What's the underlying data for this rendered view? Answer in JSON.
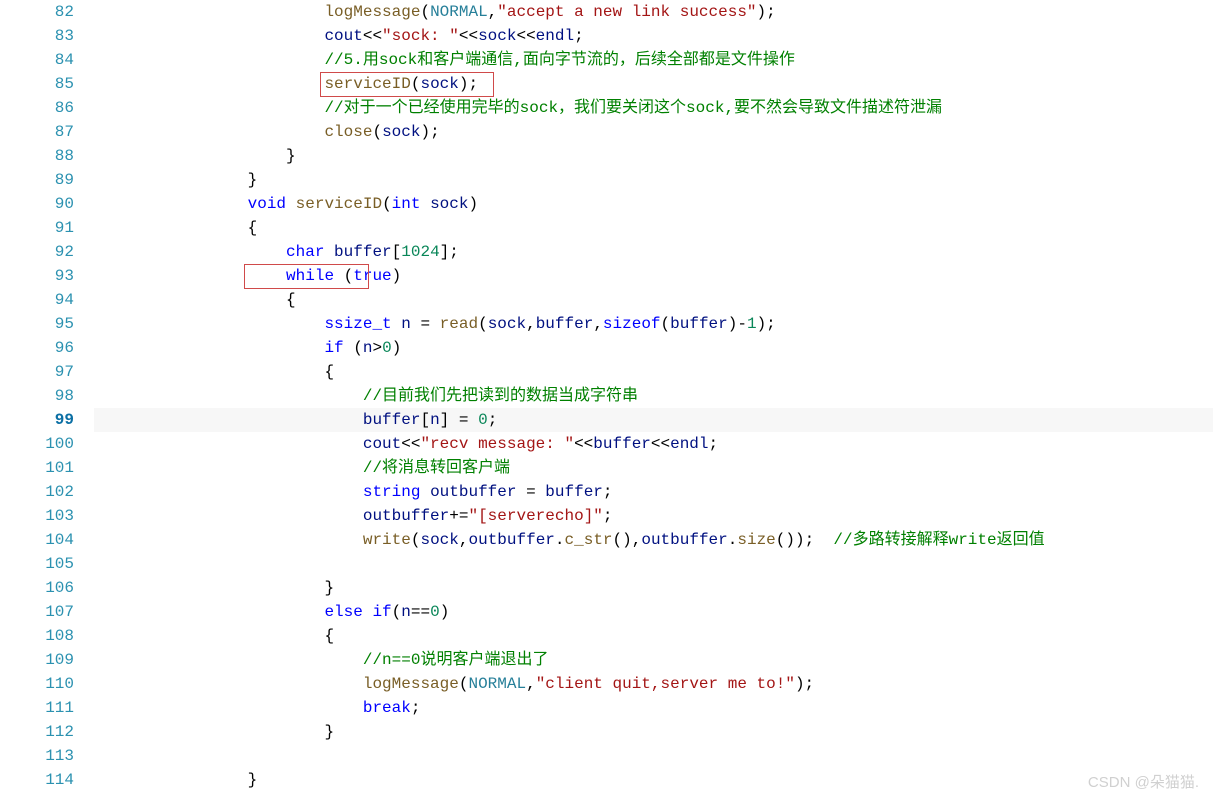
{
  "watermark": "CSDN @朵猫猫.",
  "line_start": 82,
  "line_count": 33,
  "current_line": 99,
  "boxes": [
    {
      "top_line": 85,
      "left_ch": 6,
      "width_ch": 17
    },
    {
      "top_line": 93,
      "left_ch": 4,
      "width_ch": 12
    }
  ],
  "indent_unit": "    ",
  "tokens": {
    "l82": [
      {
        "indent": 6
      },
      {
        "t": "logMessage",
        "c": "fn"
      },
      {
        "t": "("
      },
      {
        "t": "NORMAL",
        "c": "enum"
      },
      {
        "t": ","
      },
      {
        "t": "\"accept a new link success\"",
        "c": "str"
      },
      {
        "t": ");"
      }
    ],
    "l83": [
      {
        "indent": 6
      },
      {
        "t": "cout",
        "c": "var"
      },
      {
        "t": "<<"
      },
      {
        "t": "\"sock: \"",
        "c": "str"
      },
      {
        "t": "<<"
      },
      {
        "t": "sock",
        "c": "var"
      },
      {
        "t": "<<"
      },
      {
        "t": "endl",
        "c": "var"
      },
      {
        "t": ";"
      }
    ],
    "l84": [
      {
        "indent": 6
      },
      {
        "t": "//5.用sock和客户端通信,面向字节流的，后续全部都是文件操作",
        "c": "cm"
      }
    ],
    "l85": [
      {
        "indent": 6
      },
      {
        "t": "serviceID",
        "c": "fn"
      },
      {
        "t": "("
      },
      {
        "t": "sock",
        "c": "var"
      },
      {
        "t": ");"
      }
    ],
    "l86": [
      {
        "indent": 6
      },
      {
        "t": "//对于一个已经使用完毕的sock，我们要关闭这个sock,要不然会导致文件描述符泄漏",
        "c": "cm"
      }
    ],
    "l87": [
      {
        "indent": 6
      },
      {
        "t": "close",
        "c": "fn"
      },
      {
        "t": "("
      },
      {
        "t": "sock",
        "c": "var"
      },
      {
        "t": ");"
      }
    ],
    "l88": [
      {
        "indent": 5
      },
      {
        "t": "}"
      }
    ],
    "l89": [
      {
        "indent": 4
      },
      {
        "t": "}"
      }
    ],
    "l90": [
      {
        "indent": 4
      },
      {
        "t": "void ",
        "c": "kw"
      },
      {
        "t": "serviceID",
        "c": "fn"
      },
      {
        "t": "("
      },
      {
        "t": "int ",
        "c": "kw"
      },
      {
        "t": "sock",
        "c": "var"
      },
      {
        "t": ")"
      }
    ],
    "l91": [
      {
        "indent": 4
      },
      {
        "t": "{"
      }
    ],
    "l92": [
      {
        "indent": 5
      },
      {
        "t": "char ",
        "c": "kw"
      },
      {
        "t": "buffer",
        "c": "var"
      },
      {
        "t": "["
      },
      {
        "t": "1024",
        "c": "num"
      },
      {
        "t": "];"
      }
    ],
    "l93": [
      {
        "indent": 5
      },
      {
        "t": "while ",
        "c": "kw"
      },
      {
        "t": "("
      },
      {
        "t": "true",
        "c": "kw"
      },
      {
        "t": ")"
      }
    ],
    "l94": [
      {
        "indent": 5
      },
      {
        "t": "{"
      }
    ],
    "l95": [
      {
        "indent": 6
      },
      {
        "t": "ssize_t ",
        "c": "ty"
      },
      {
        "t": "n",
        "c": "var"
      },
      {
        "t": " = "
      },
      {
        "t": "read",
        "c": "fn"
      },
      {
        "t": "("
      },
      {
        "t": "sock",
        "c": "var"
      },
      {
        "t": ","
      },
      {
        "t": "buffer",
        "c": "var"
      },
      {
        "t": ","
      },
      {
        "t": "sizeof",
        "c": "kw"
      },
      {
        "t": "("
      },
      {
        "t": "buffer",
        "c": "var"
      },
      {
        "t": ")-"
      },
      {
        "t": "1",
        "c": "num"
      },
      {
        "t": ");"
      }
    ],
    "l96": [
      {
        "indent": 6
      },
      {
        "t": "if ",
        "c": "kw"
      },
      {
        "t": "("
      },
      {
        "t": "n",
        "c": "var"
      },
      {
        "t": ">"
      },
      {
        "t": "0",
        "c": "num"
      },
      {
        "t": ")"
      }
    ],
    "l97": [
      {
        "indent": 6
      },
      {
        "t": "{"
      }
    ],
    "l98": [
      {
        "indent": 7
      },
      {
        "t": "//目前我们先把读到的数据当成字符串",
        "c": "cm"
      }
    ],
    "l99": [
      {
        "indent": 7
      },
      {
        "t": "buffer",
        "c": "var"
      },
      {
        "t": "["
      },
      {
        "t": "n",
        "c": "var"
      },
      {
        "t": "] = "
      },
      {
        "t": "0",
        "c": "num"
      },
      {
        "t": ";"
      }
    ],
    "l100": [
      {
        "indent": 7
      },
      {
        "t": "cout",
        "c": "var"
      },
      {
        "t": "<<"
      },
      {
        "t": "\"recv message: \"",
        "c": "str"
      },
      {
        "t": "<<"
      },
      {
        "t": "buffer",
        "c": "var"
      },
      {
        "t": "<<"
      },
      {
        "t": "endl",
        "c": "var"
      },
      {
        "t": ";"
      }
    ],
    "l101": [
      {
        "indent": 7
      },
      {
        "t": "//将消息转回客户端",
        "c": "cm"
      }
    ],
    "l102": [
      {
        "indent": 7
      },
      {
        "t": "string ",
        "c": "ty"
      },
      {
        "t": "outbuffer",
        "c": "var"
      },
      {
        "t": " = "
      },
      {
        "t": "buffer",
        "c": "var"
      },
      {
        "t": ";"
      }
    ],
    "l103": [
      {
        "indent": 7
      },
      {
        "t": "outbuffer",
        "c": "var"
      },
      {
        "t": "+="
      },
      {
        "t": "\"[serverecho]\"",
        "c": "str"
      },
      {
        "t": ";"
      }
    ],
    "l104": [
      {
        "indent": 7
      },
      {
        "t": "write",
        "c": "fn"
      },
      {
        "t": "("
      },
      {
        "t": "sock",
        "c": "var"
      },
      {
        "t": ","
      },
      {
        "t": "outbuffer",
        "c": "var"
      },
      {
        "t": "."
      },
      {
        "t": "c_str",
        "c": "fn"
      },
      {
        "t": "(),"
      },
      {
        "t": "outbuffer",
        "c": "var"
      },
      {
        "t": "."
      },
      {
        "t": "size",
        "c": "fn"
      },
      {
        "t": "());  "
      },
      {
        "t": "//多路转接解释write返回值",
        "c": "cm"
      }
    ],
    "l105": [
      {
        "indent": 0
      }
    ],
    "l106": [
      {
        "indent": 6
      },
      {
        "t": "}"
      }
    ],
    "l107": [
      {
        "indent": 6
      },
      {
        "t": "else if",
        "c": "kw"
      },
      {
        "t": "("
      },
      {
        "t": "n",
        "c": "var"
      },
      {
        "t": "=="
      },
      {
        "t": "0",
        "c": "num"
      },
      {
        "t": ")"
      }
    ],
    "l108": [
      {
        "indent": 6
      },
      {
        "t": "{"
      }
    ],
    "l109": [
      {
        "indent": 7
      },
      {
        "t": "//n==0说明客户端退出了",
        "c": "cm"
      }
    ],
    "l110": [
      {
        "indent": 7
      },
      {
        "t": "logMessage",
        "c": "fn"
      },
      {
        "t": "("
      },
      {
        "t": "NORMAL",
        "c": "enum"
      },
      {
        "t": ","
      },
      {
        "t": "\"client quit,server me to!\"",
        "c": "str"
      },
      {
        "t": ");"
      }
    ],
    "l111": [
      {
        "indent": 7
      },
      {
        "t": "break",
        "c": "kw"
      },
      {
        "t": ";"
      }
    ],
    "l112": [
      {
        "indent": 6
      },
      {
        "t": "}"
      }
    ],
    "l113": [
      {
        "indent": 0
      }
    ],
    "l114": [
      {
        "indent": 4
      },
      {
        "t": "}"
      }
    ]
  }
}
